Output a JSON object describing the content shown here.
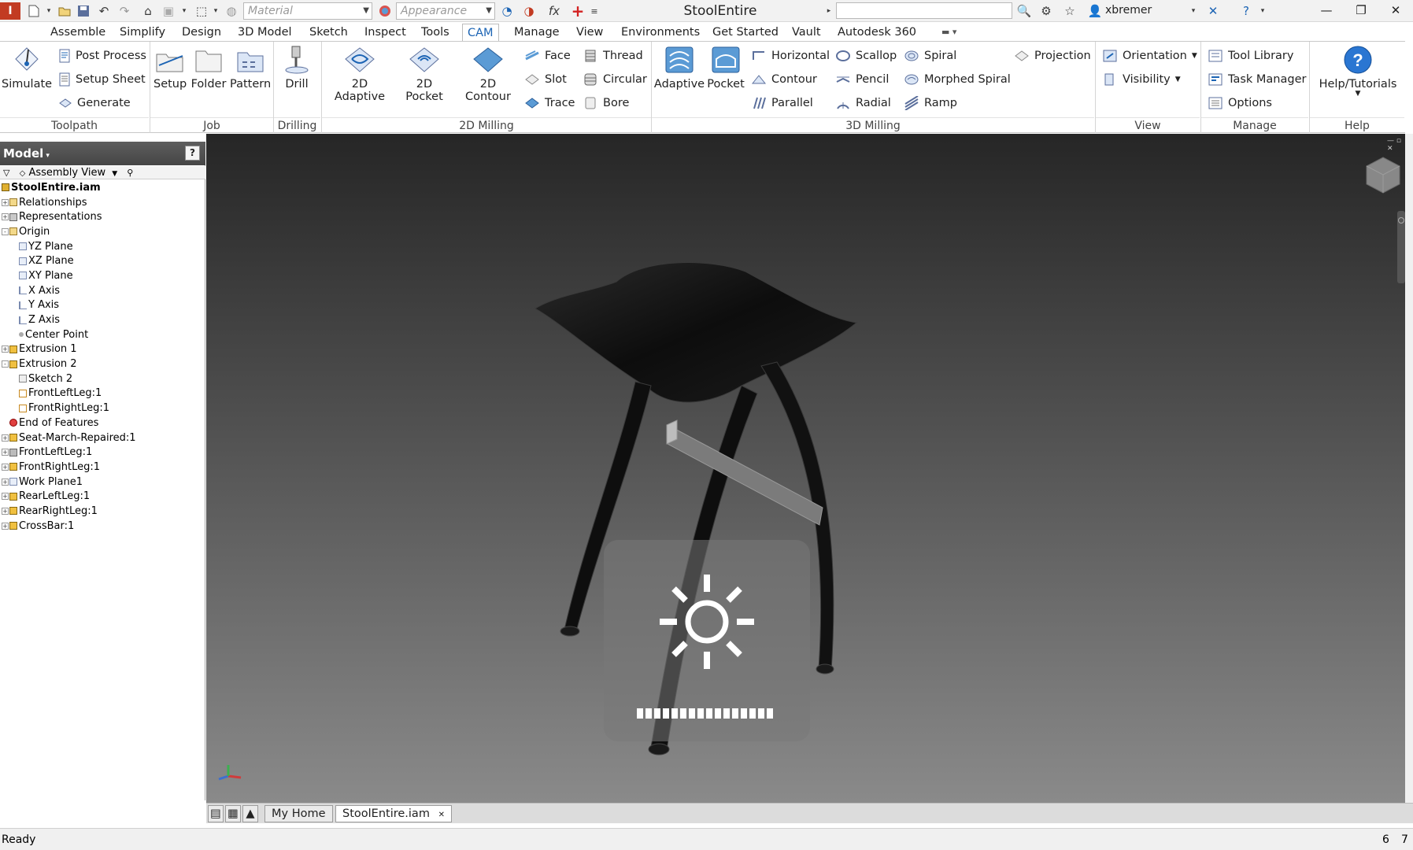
{
  "titlebar": {
    "document_title": "StoolEntire",
    "material_placeholder": "Material",
    "appearance_placeholder": "Appearance",
    "username": "xbremer",
    "formula_glyph": "fx"
  },
  "menu": {
    "tabs": [
      "Assemble",
      "Simplify",
      "Design",
      "3D Model",
      "Sketch",
      "Inspect",
      "Tools",
      "CAM",
      "Manage",
      "View",
      "Environments",
      "Get Started",
      "Vault",
      "Autodesk 360"
    ],
    "active_tab": "CAM"
  },
  "ribbon": {
    "toolpath": {
      "label": "Toolpath",
      "simulate": "Simulate",
      "post_process": "Post Process",
      "setup_sheet": "Setup Sheet",
      "generate": "Generate"
    },
    "job": {
      "label": "Job",
      "setup": "Setup",
      "folder": "Folder",
      "pattern": "Pattern"
    },
    "drilling": {
      "label": "Drilling",
      "drill": "Drill"
    },
    "milling_2d": {
      "label": "2D Milling",
      "adaptive": "2D Adaptive",
      "pocket": "2D Pocket",
      "contour": "2D Contour",
      "face": "Face",
      "slot": "Slot",
      "trace": "Trace",
      "thread": "Thread",
      "circular": "Circular",
      "bore": "Bore"
    },
    "milling_3d": {
      "label": "3D Milling",
      "adaptive": "Adaptive",
      "pocket": "Pocket",
      "horizontal": "Horizontal",
      "contour": "Contour",
      "parallel": "Parallel",
      "scallop": "Scallop",
      "pencil": "Pencil",
      "radial": "Radial",
      "spiral": "Spiral",
      "morphed_spiral": "Morphed Spiral",
      "ramp": "Ramp",
      "projection": "Projection"
    },
    "view": {
      "label": "View",
      "orientation": "Orientation",
      "visibility": "Visibility"
    },
    "manage": {
      "label": "Manage",
      "tool_library": "Tool Library",
      "task_manager": "Task Manager",
      "options": "Options"
    },
    "help": {
      "label": "Help",
      "help_tutorials": "Help/Tutorials"
    }
  },
  "model_panel": {
    "title": "Model",
    "help_glyph": "?",
    "view_mode": "Assembly View",
    "tree": [
      {
        "label": "StoolEntire.iam",
        "indent": 0,
        "root": true,
        "icon": "assembly",
        "expander": ""
      },
      {
        "label": "Relationships",
        "indent": 1,
        "icon": "folder",
        "expander": "+"
      },
      {
        "label": "Representations",
        "indent": 1,
        "icon": "representations",
        "expander": "+"
      },
      {
        "label": "Origin",
        "indent": 1,
        "icon": "folder-open",
        "expander": "-"
      },
      {
        "label": "YZ Plane",
        "indent": 2,
        "icon": "plane",
        "expander": ""
      },
      {
        "label": "XZ Plane",
        "indent": 2,
        "icon": "plane",
        "expander": ""
      },
      {
        "label": "XY Plane",
        "indent": 2,
        "icon": "plane",
        "expander": ""
      },
      {
        "label": "X Axis",
        "indent": 2,
        "icon": "axis",
        "expander": ""
      },
      {
        "label": "Y Axis",
        "indent": 2,
        "icon": "axis",
        "expander": ""
      },
      {
        "label": "Z Axis",
        "indent": 2,
        "icon": "axis",
        "expander": ""
      },
      {
        "label": "Center Point",
        "indent": 2,
        "icon": "point",
        "expander": ""
      },
      {
        "label": "Extrusion 1",
        "indent": 1,
        "icon": "extrusion",
        "expander": "+"
      },
      {
        "label": "Extrusion 2",
        "indent": 1,
        "icon": "extrusion",
        "expander": "-"
      },
      {
        "label": "Sketch 2",
        "indent": 2,
        "icon": "sketch",
        "expander": ""
      },
      {
        "label": "FrontLeftLeg:1",
        "indent": 2,
        "icon": "part-link",
        "expander": ""
      },
      {
        "label": "FrontRightLeg:1",
        "indent": 2,
        "icon": "part-link",
        "expander": ""
      },
      {
        "label": "End of Features",
        "indent": 1,
        "icon": "end",
        "expander": ""
      },
      {
        "label": "Seat-March-Repaired:1",
        "indent": 1,
        "icon": "part",
        "expander": "+"
      },
      {
        "label": "FrontLeftLeg:1",
        "indent": 1,
        "icon": "part-grey",
        "expander": "+"
      },
      {
        "label": "FrontRightLeg:1",
        "indent": 1,
        "icon": "part",
        "expander": "+"
      },
      {
        "label": "Work Plane1",
        "indent": 1,
        "icon": "plane",
        "expander": "+"
      },
      {
        "label": "RearLeftLeg:1",
        "indent": 1,
        "icon": "part",
        "expander": "+"
      },
      {
        "label": "RearRightLeg:1",
        "indent": 1,
        "icon": "part",
        "expander": "+"
      },
      {
        "label": "CrossBar:1",
        "indent": 1,
        "icon": "part",
        "expander": "+"
      }
    ]
  },
  "viewport": {
    "overlay_icon": "brightness-icon",
    "brightness_level": 1.0,
    "brightness_segments": 16
  },
  "doc_tabs": {
    "home": "My Home",
    "active": "StoolEntire.iam"
  },
  "status": {
    "text": "Ready",
    "count_a": "6",
    "count_b": "7"
  },
  "colors": {
    "accent": "#1c64b4",
    "panel_header": "#4f4f4f"
  }
}
